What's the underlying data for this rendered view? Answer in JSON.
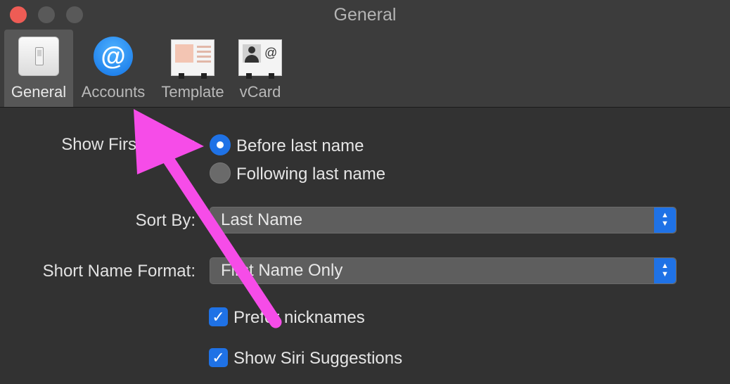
{
  "window": {
    "title": "General"
  },
  "toolbar": {
    "tabs": [
      {
        "label": "General",
        "icon": "switch-icon",
        "selected": true
      },
      {
        "label": "Accounts",
        "icon": "at-icon",
        "selected": false
      },
      {
        "label": "Template",
        "icon": "template-card-icon",
        "selected": false
      },
      {
        "label": "vCard",
        "icon": "vcard-icon",
        "selected": false
      }
    ],
    "vcard_at": "@",
    "accounts_at": "@"
  },
  "show_first_name": {
    "label": "Show First Name:",
    "options": [
      {
        "label": "Before last name",
        "selected": true
      },
      {
        "label": "Following last name",
        "selected": false
      }
    ]
  },
  "sort_by": {
    "label": "Sort By:",
    "value": "Last Name"
  },
  "short_name_format": {
    "label": "Short Name Format:",
    "value": "First Name Only"
  },
  "checkboxes": [
    {
      "label": "Prefer nicknames",
      "checked": true
    },
    {
      "label": "Show Siri Suggestions",
      "checked": true
    }
  ],
  "colors": {
    "accent": "#1f72e6",
    "annotation_arrow": "#f64ce8",
    "window_bg": "#323232",
    "toolbar_bg": "#3c3c3c"
  }
}
